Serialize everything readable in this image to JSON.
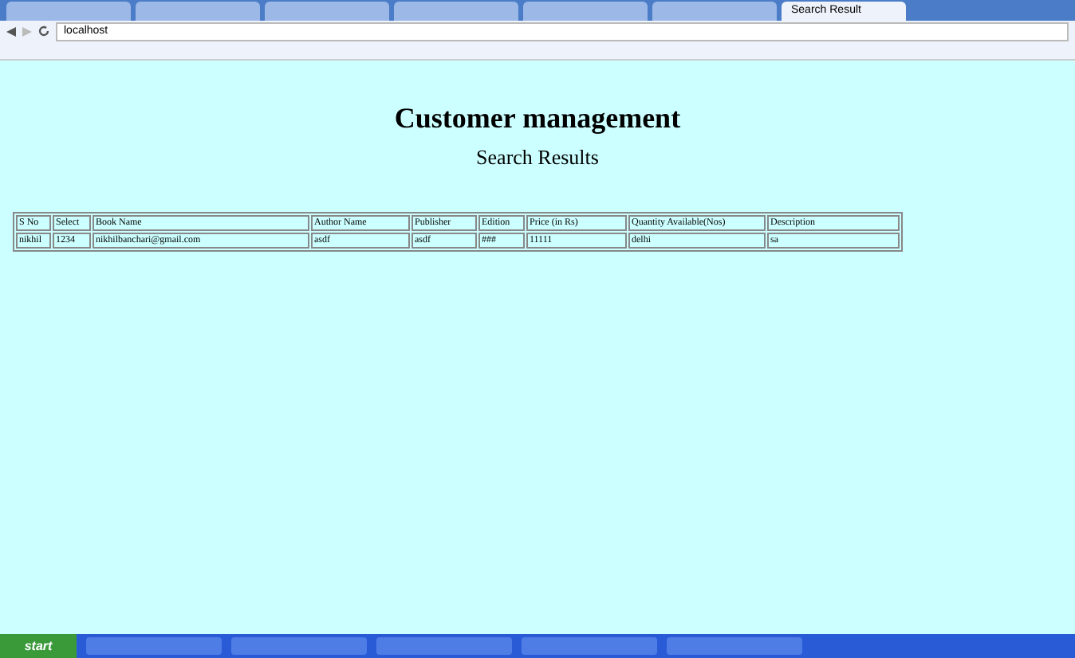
{
  "browser": {
    "tabs": [
      {
        "selected": false
      },
      {
        "selected": false
      },
      {
        "selected": false
      },
      {
        "selected": false
      },
      {
        "selected": false
      },
      {
        "selected": false
      },
      {
        "title": "Search Result",
        "selected": true
      }
    ],
    "address": "localhost"
  },
  "page": {
    "title": "Customer management",
    "subtitle": "Search Results"
  },
  "table": {
    "columns": [
      "S No",
      "Select",
      "Book Name",
      "Author Name",
      "Publisher",
      "Edition",
      "Price (in Rs)",
      "Quantity Available(Nos)",
      "Description"
    ],
    "rows": [
      [
        "nikhil",
        "1234",
        "nikhilbanchari@gmail.com",
        "asdf",
        "asdf",
        "###",
        "11111",
        "delhi",
        "sa"
      ]
    ]
  },
  "taskbar": {
    "start": "start"
  }
}
